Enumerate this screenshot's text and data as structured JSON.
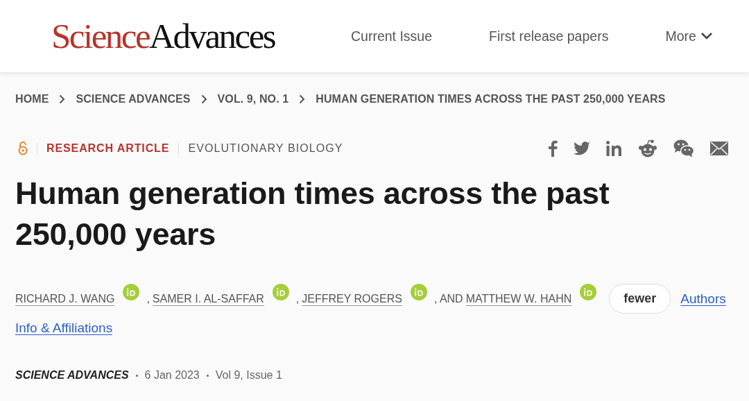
{
  "logo": {
    "first": "Science",
    "second": "Advances"
  },
  "nav": [
    {
      "label": "Current Issue",
      "kind": "link"
    },
    {
      "label": "First release papers",
      "kind": "link"
    },
    {
      "label": "More",
      "kind": "menu"
    }
  ],
  "breadcrumb": [
    "HOME",
    "SCIENCE ADVANCES",
    "VOL. 9, NO. 1",
    "HUMAN GENERATION TIMES ACROSS THE PAST 250,000 YEARS"
  ],
  "article": {
    "type": "RESEARCH ARTICLE",
    "subject": "EVOLUTIONARY BIOLOGY",
    "title": "Human generation times across the past 250,000 years"
  },
  "authors": [
    {
      "name": "RICHARD J. WANG"
    },
    {
      "separator": ",",
      "name": "SAMER I. AL-SAFFAR"
    },
    {
      "separator": ",",
      "name": "JEFFREY ROGERS"
    },
    {
      "separator": ", AND",
      "name": "MATTHEW W. HAHN"
    }
  ],
  "toggle": "fewer",
  "authors_link": "Authors",
  "info_link": "Info & Affiliations",
  "meta": {
    "journal": "SCIENCE ADVANCES",
    "date": "6 Jan 2023",
    "issue": "Vol 9, Issue 1"
  }
}
